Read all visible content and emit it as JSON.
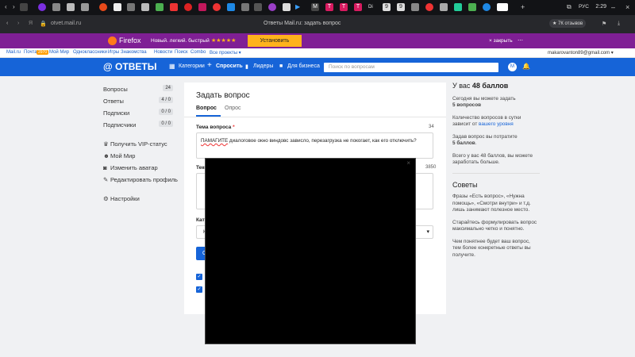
{
  "browser": {
    "tab_letters": [
      "M",
      "T",
      "T",
      "T",
      "Di",
      "9",
      "9"
    ],
    "lang": "РУС",
    "time": "2:29",
    "url": "otvet.mail.ru",
    "page_title": "Ответы Mail.ru: задать вопрос",
    "reviews": "7К отзывов"
  },
  "promo": {
    "brand": "Firefox",
    "tagline": "Новый. легкий. быстрый",
    "stars": "★★★★★",
    "install": "Установить",
    "close": "× закрыть"
  },
  "portal": {
    "links": [
      "Mail.ru",
      "Почта",
      "Мой Мир",
      "Одноклассники",
      "Игры",
      "Знакомства",
      "Новости",
      "Поиск",
      "Combo",
      "Все проекты ▾"
    ],
    "mail_count": "2970",
    "email": "makarovanton89@gmail.com ▾"
  },
  "header": {
    "logo": "@ ОТВЕТЫ",
    "categories": "Категории",
    "ask": "Спросить",
    "leaders": "Лидеры",
    "business": "Для бизнеса",
    "search_placeholder": "Поиск по вопросам",
    "avatar": "M"
  },
  "nav": {
    "counters": [
      {
        "label": "Вопросы",
        "count": "24"
      },
      {
        "label": "Ответы",
        "count": "4 / 0"
      },
      {
        "label": "Подписки",
        "count": "0 / 0"
      },
      {
        "label": "Подписчики",
        "count": "0 / 0"
      }
    ],
    "links": [
      {
        "label": "Получить VIP-статус"
      },
      {
        "label": "Мой Мир"
      },
      {
        "label": "Изменить аватар"
      },
      {
        "label": "Редактировать профиль"
      },
      {
        "label": "Настройки"
      }
    ]
  },
  "form": {
    "title": "Задать вопрос",
    "tab_question": "Вопрос",
    "tab_poll": "Опрос",
    "topic_label": "Тема вопроса",
    "topic_count": "34",
    "topic_value_first": "ПАМАГИТЕ",
    "topic_value_rest": " диалоговое окно виндовс зависло, перезагрузка не покогает, как его отключить?",
    "text_label_partial": "Текс",
    "text_count": "3850",
    "category_label_partial": "Кат",
    "category_value_partial": "К",
    "submit_partial": "С"
  },
  "right": {
    "points_prefix": "У вас ",
    "points": "48 баллов",
    "today_text": "Сегодня вы можете задать",
    "today_value": "5 вопросов",
    "count_text": "Количество вопросов в сутки зависит от ",
    "count_link": "вашего уровня",
    "spend_text": "Задав вопрос вы потратите",
    "spend_value": "5 баллов",
    "total_text": "Всего у вас 48 баллов, вы можете заработать больше.",
    "tips_title": "Советы",
    "tip1": "Фразы «Есть вопрос», «Нужна помощь», «Смотри внутри» и т.д. лишь занимают полезное место.",
    "tip2": "Старайтесь формулировать вопрос максимально четко и понятно.",
    "tip3": "Чем понятнее будет ваш вопрос, тем более конкретные ответы вы получите."
  },
  "modal": {
    "close": "×"
  },
  "colors": {
    "accent": "#1664d8",
    "promo": "#7f1f95",
    "install": "#ffb21c"
  }
}
